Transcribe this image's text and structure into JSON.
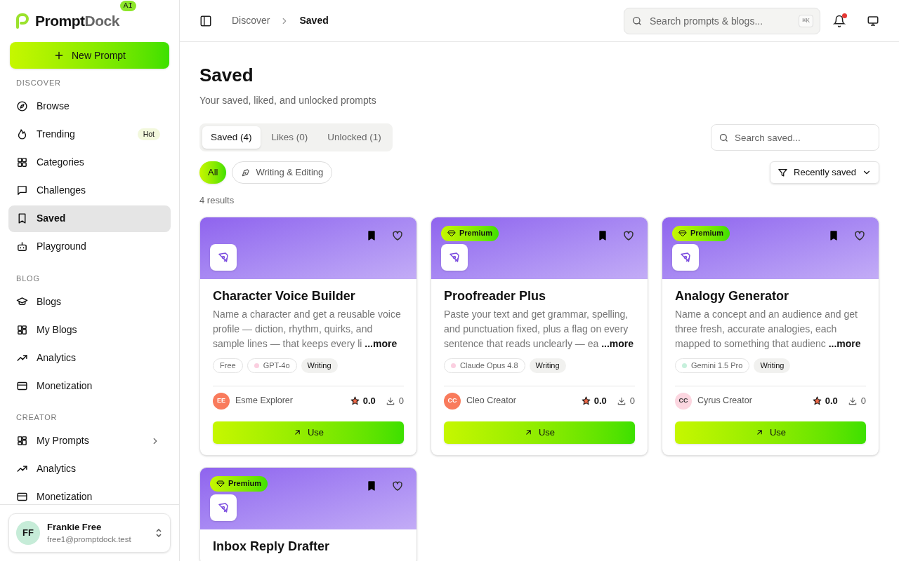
{
  "brand": {
    "name_strong": "Prompt",
    "name_light": "Dock",
    "badge": "AI"
  },
  "new_button": "New Prompt",
  "sidebar": {
    "sections": [
      {
        "title": "DISCOVER",
        "items": [
          {
            "label": "Browse",
            "selected": false
          },
          {
            "label": "Trending",
            "selected": false,
            "badge": "Hot"
          },
          {
            "label": "Categories",
            "selected": false
          },
          {
            "label": "Challenges",
            "selected": false
          },
          {
            "label": "Saved",
            "selected": true
          },
          {
            "label": "Playground",
            "selected": false
          }
        ]
      },
      {
        "title": "BLOG",
        "items": [
          {
            "label": "Blogs",
            "selected": false
          },
          {
            "label": "My Blogs",
            "selected": false
          },
          {
            "label": "Analytics",
            "selected": false
          },
          {
            "label": "Monetization",
            "selected": false
          }
        ]
      },
      {
        "title": "CREATOR",
        "items": [
          {
            "label": "My Prompts",
            "selected": false,
            "expanded": false
          },
          {
            "label": "Analytics",
            "selected": false
          },
          {
            "label": "Monetization",
            "selected": false
          }
        ]
      }
    ]
  },
  "user": {
    "initials": "FF",
    "name": "Frankie Free",
    "email": "free1@promptdock.test"
  },
  "breadcrumb": [
    "Discover",
    "Saved"
  ],
  "search": {
    "placeholder": "Search prompts & blogs...",
    "shortcut": "⌘K"
  },
  "notifications": {
    "unread": true
  },
  "page": {
    "title": "Saved",
    "subtitle": "Your saved, liked, and unlocked prompts"
  },
  "tabs": [
    {
      "label": "Saved (4)",
      "selected": true
    },
    {
      "label": "Likes (0)",
      "selected": false
    },
    {
      "label": "Unlocked (1)",
      "selected": false
    }
  ],
  "saved_search": {
    "placeholder": "Search saved..."
  },
  "filters": [
    {
      "label": "All",
      "selected": true
    },
    {
      "label": "Writing & Editing",
      "selected": false
    }
  ],
  "sort": "Recently saved",
  "results": "4 results",
  "cards": [
    {
      "premium": false,
      "saved": true,
      "liked": false,
      "title": "Character Voice Builder",
      "description": "Name a character and get a reusable voice profile — diction, rhythm, quirks, and sample lines — that keeps every li",
      "more": "...more",
      "tags": [
        {
          "kind": "price",
          "label": "Free"
        },
        {
          "kind": "model",
          "label": "GPT-4o",
          "color": "#fbcfe0"
        },
        {
          "kind": "category",
          "label": "Writing"
        }
      ],
      "author": {
        "initials": "EE",
        "name": "Esme Explorer",
        "color": "#f97b5c"
      },
      "rating": "0.0",
      "downloads": "0",
      "action": "Use"
    },
    {
      "premium": true,
      "premium_label": "Premium",
      "saved": true,
      "liked": false,
      "title": "Proofreader Plus",
      "description": "Paste your text and get grammar, spelling, and punctuation fixed, plus a flag on every sentence that reads unclearly — ea",
      "more": "...more",
      "tags": [
        {
          "kind": "model",
          "label": "Claude Opus 4.8",
          "color": "#fbcfe0"
        },
        {
          "kind": "category",
          "label": "Writing"
        }
      ],
      "author": {
        "initials": "CC",
        "name": "Cleo Creator",
        "color": "#f97b5c"
      },
      "rating": "0.0",
      "downloads": "0",
      "action": "Use"
    },
    {
      "premium": true,
      "premium_label": "Premium",
      "saved": true,
      "liked": false,
      "title": "Analogy Generator",
      "description": "Name a concept and an audience and get three fresh, accurate analogies, each mapped to something that audienc",
      "more": "...more",
      "tags": [
        {
          "kind": "model",
          "label": "Gemini 1.5 Pro",
          "color": "#c6f0dc"
        },
        {
          "kind": "category",
          "label": "Writing"
        }
      ],
      "author": {
        "initials": "CC",
        "name": "Cyrus Creator",
        "color": "#fcd6e0"
      },
      "rating": "0.0",
      "downloads": "0",
      "action": "Use"
    },
    {
      "premium": true,
      "premium_label": "Premium",
      "saved": true,
      "liked": false,
      "title": "Inbox Reply Drafter"
    }
  ]
}
